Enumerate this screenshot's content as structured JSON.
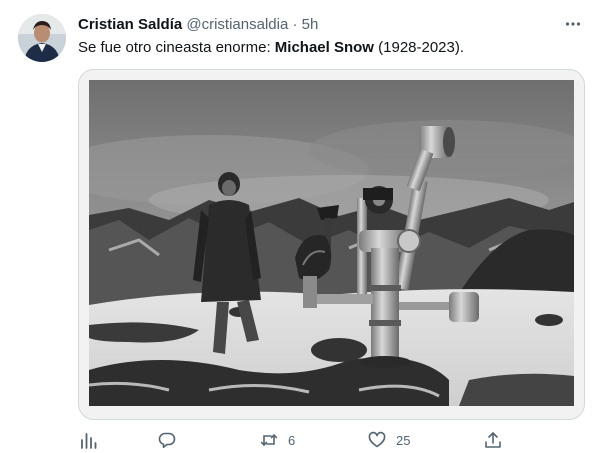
{
  "tweet": {
    "author_name": "Cristian Saldía",
    "handle": "@cristiansaldia",
    "separator": "·",
    "time": "5h",
    "text_before": "Se fue otro cineasta enorme: ",
    "text_bold": "Michael Snow",
    "text_after": " (1928-2023)."
  },
  "actions": {
    "analytics_icon": "bar-chart-icon",
    "reply_icon": "speech-bubble-icon",
    "retweet_icon": "retweet-arrows-icon",
    "retweet_count": "6",
    "like_icon": "heart-icon",
    "like_count": "25",
    "share_icon": "share-upload-icon"
  },
  "colors": {
    "text": "#0f1419",
    "muted": "#536471",
    "border": "#cfd9de"
  }
}
